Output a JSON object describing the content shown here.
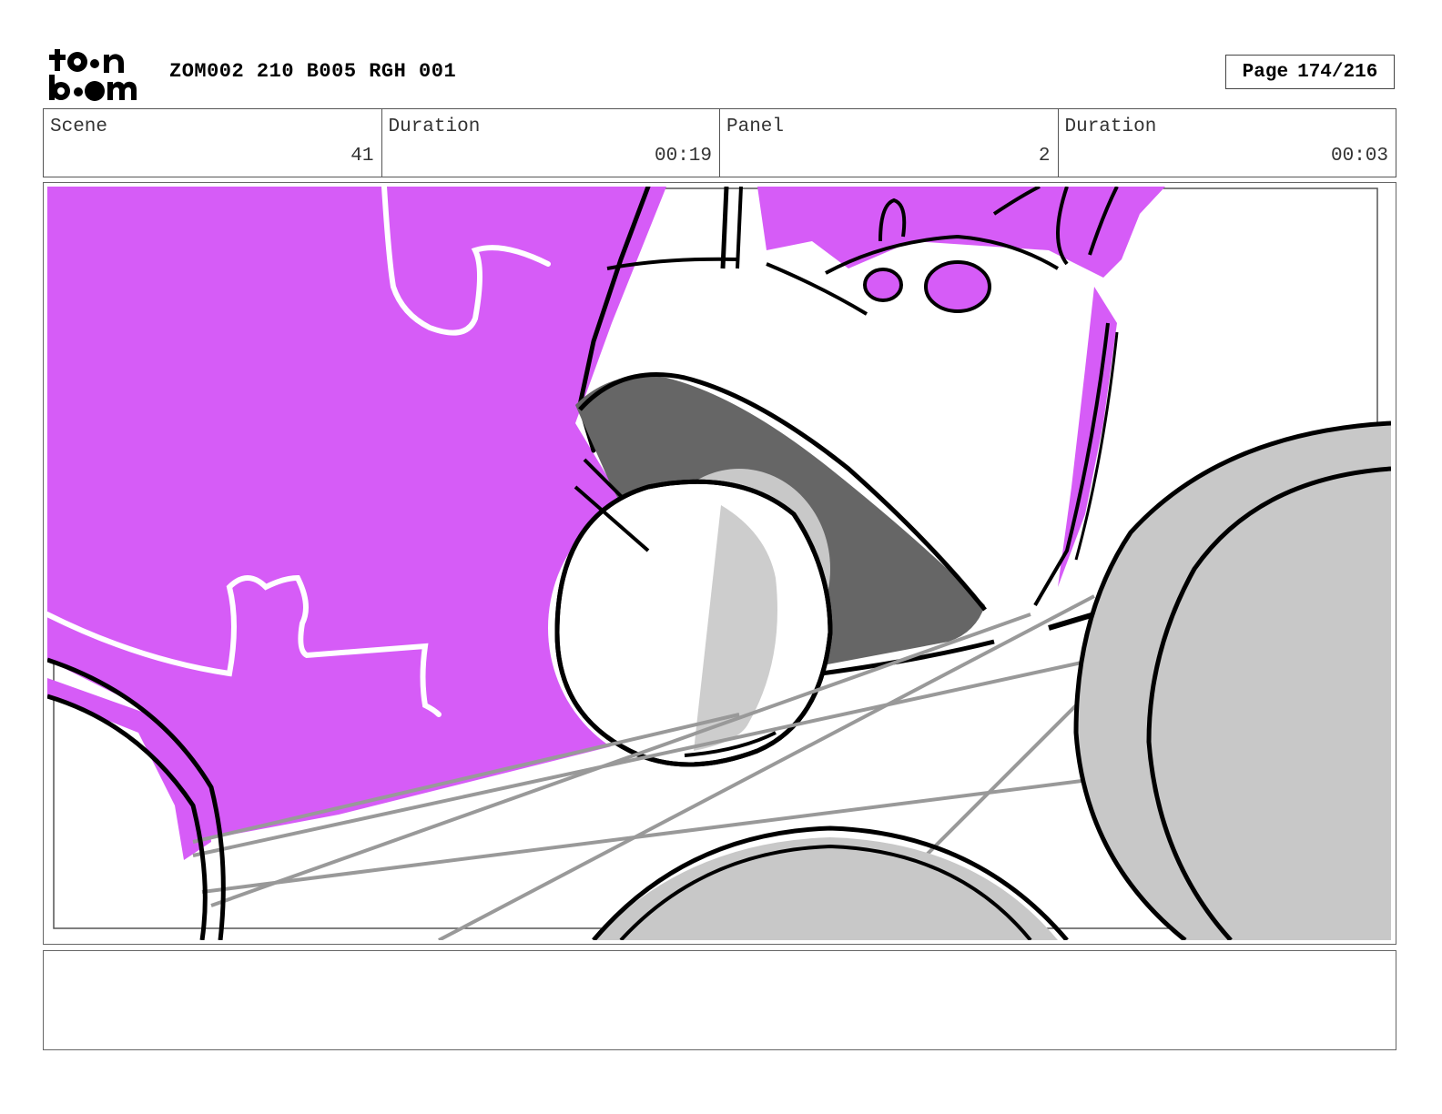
{
  "header": {
    "logo_text": "toon boom",
    "title": "ZOM002 210 B005 RGH 001",
    "page_label": "Page",
    "page_value": "174/216"
  },
  "info": {
    "scene_label": "Scene",
    "scene_value": "41",
    "scene_duration_label": "Duration",
    "scene_duration_value": "00:19",
    "panel_label": "Panel",
    "panel_value": "2",
    "panel_duration_label": "Duration",
    "panel_duration_value": "00:03"
  },
  "notes": {
    "text": ""
  },
  "colors": {
    "magenta": "#d65cf7",
    "dark_grey": "#666666",
    "light_grey": "#c8c8c8",
    "line": "#000000"
  }
}
